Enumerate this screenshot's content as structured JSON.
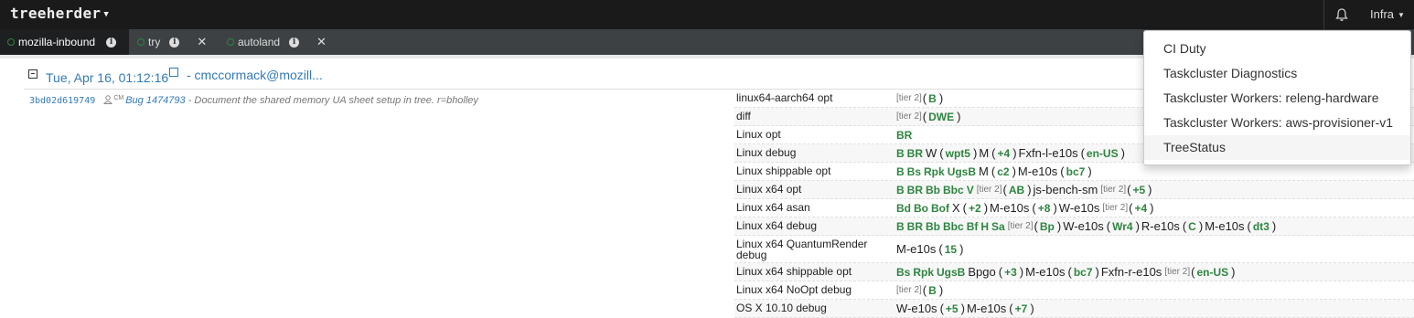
{
  "navbar": {
    "logo_text": "treeherder",
    "bell_icon": "bell-icon",
    "menu_label": "Infra"
  },
  "repo_tabs": [
    {
      "name": "mozilla-inbound",
      "active": true,
      "closable": false
    },
    {
      "name": "try",
      "active": false,
      "closable": true
    },
    {
      "name": "autoland",
      "active": false,
      "closable": true
    }
  ],
  "push": {
    "date": "Tue, Apr 16, 01:12:16",
    "author": " - cmccormack@mozill..."
  },
  "revision": {
    "hash": "3bd02d619749",
    "cm_mark": "CM",
    "bug": "Bug 1474793",
    "description": " - Document the shared memory UA sheet setup in tree. r=bholley"
  },
  "jobs": [
    {
      "platform": "linux64-aarch64 opt",
      "tokens": [
        [
          "tier",
          "[tier 2]"
        ],
        [
          "par",
          "("
        ],
        [
          "g",
          "B"
        ],
        [
          "par",
          ")"
        ]
      ]
    },
    {
      "platform": "diff",
      "tokens": [
        [
          "tier",
          "[tier 2]"
        ],
        [
          "par",
          "("
        ],
        [
          "g",
          "DWE"
        ],
        [
          "par",
          ")"
        ]
      ]
    },
    {
      "platform": "Linux opt",
      "tokens": [
        [
          "g",
          "BR"
        ]
      ]
    },
    {
      "platform": "Linux debug",
      "tokens": [
        [
          "g",
          "B"
        ],
        [
          "g",
          "BR"
        ],
        [
          "grp",
          "W"
        ],
        [
          "par",
          "("
        ],
        [
          "g",
          "wpt5"
        ],
        [
          "par",
          ")"
        ],
        [
          "grp",
          "M"
        ],
        [
          "par",
          "("
        ],
        [
          "g",
          "+4"
        ],
        [
          "par",
          ")"
        ],
        [
          "grp",
          "Fxfn-l-e10s"
        ],
        [
          "par",
          "("
        ],
        [
          "g",
          "en-US"
        ],
        [
          "par",
          ")"
        ]
      ]
    },
    {
      "platform": "Linux shippable opt",
      "tokens": [
        [
          "g",
          "B"
        ],
        [
          "g",
          "Bs"
        ],
        [
          "g",
          "Rpk"
        ],
        [
          "g",
          "UgsB"
        ],
        [
          "grp",
          "M"
        ],
        [
          "par",
          "("
        ],
        [
          "g",
          "c2"
        ],
        [
          "par",
          ")"
        ],
        [
          "grp",
          "M-e10s"
        ],
        [
          "par",
          "("
        ],
        [
          "g",
          "bc7"
        ],
        [
          "par",
          ")"
        ]
      ]
    },
    {
      "platform": "Linux x64 opt",
      "tokens": [
        [
          "g",
          "B"
        ],
        [
          "g",
          "BR"
        ],
        [
          "g",
          "Bb"
        ],
        [
          "g",
          "Bbc"
        ],
        [
          "g",
          "V"
        ],
        [
          "tier",
          "[tier 2]"
        ],
        [
          "par",
          "("
        ],
        [
          "g",
          "AB"
        ],
        [
          "par",
          ")"
        ],
        [
          "grp",
          "js-bench-sm"
        ],
        [
          "tier",
          "[tier 2]"
        ],
        [
          "par",
          "("
        ],
        [
          "g",
          "+5"
        ],
        [
          "par",
          ")"
        ]
      ]
    },
    {
      "platform": "Linux x64 asan",
      "tokens": [
        [
          "g",
          "Bd"
        ],
        [
          "g",
          "Bo"
        ],
        [
          "g",
          "Bof"
        ],
        [
          "grp",
          "X"
        ],
        [
          "par",
          "("
        ],
        [
          "g",
          "+2"
        ],
        [
          "par",
          ")"
        ],
        [
          "grp",
          "M-e10s"
        ],
        [
          "par",
          "("
        ],
        [
          "g",
          "+8"
        ],
        [
          "par",
          ")"
        ],
        [
          "grp",
          "W-e10s"
        ],
        [
          "tier",
          "[tier 2]"
        ],
        [
          "par",
          "("
        ],
        [
          "g",
          "+4"
        ],
        [
          "par",
          ")"
        ]
      ]
    },
    {
      "platform": "Linux x64 debug",
      "tokens": [
        [
          "g",
          "B"
        ],
        [
          "g",
          "BR"
        ],
        [
          "g",
          "Bb"
        ],
        [
          "g",
          "Bbc"
        ],
        [
          "g",
          "Bf"
        ],
        [
          "g",
          "H"
        ],
        [
          "g",
          "Sa"
        ],
        [
          "tier",
          "[tier 2]"
        ],
        [
          "par",
          "("
        ],
        [
          "g",
          "Bp"
        ],
        [
          "par",
          ")"
        ],
        [
          "grp",
          "W-e10s"
        ],
        [
          "par",
          "("
        ],
        [
          "g",
          "Wr4"
        ],
        [
          "par",
          ")"
        ],
        [
          "grp",
          "R-e10s"
        ],
        [
          "par",
          "("
        ],
        [
          "g",
          "C"
        ],
        [
          "par",
          ")"
        ],
        [
          "grp",
          "M-e10s"
        ],
        [
          "par",
          "("
        ],
        [
          "g",
          "dt3"
        ],
        [
          "par",
          ")"
        ]
      ]
    },
    {
      "platform": "Linux x64 QuantumRender debug",
      "tall": true,
      "tokens": [
        [
          "grp",
          "M-e10s"
        ],
        [
          "par",
          "("
        ],
        [
          "g",
          "15"
        ],
        [
          "par",
          ")"
        ]
      ]
    },
    {
      "platform": "Linux x64 shippable opt",
      "tokens": [
        [
          "g",
          "Bs"
        ],
        [
          "g",
          "Rpk"
        ],
        [
          "g",
          "UgsB"
        ],
        [
          "grp",
          "Bpgo"
        ],
        [
          "par",
          "("
        ],
        [
          "g",
          "+3"
        ],
        [
          "par",
          ")"
        ],
        [
          "grp",
          "M-e10s"
        ],
        [
          "par",
          "("
        ],
        [
          "g",
          "bc7"
        ],
        [
          "par",
          ")"
        ],
        [
          "grp",
          "Fxfn-r-e10s"
        ],
        [
          "tier",
          "[tier 2]"
        ],
        [
          "par",
          "("
        ],
        [
          "g",
          "en-US"
        ],
        [
          "par",
          ")"
        ]
      ]
    },
    {
      "platform": "Linux x64 NoOpt debug",
      "tokens": [
        [
          "tier",
          "[tier 2]"
        ],
        [
          "par",
          "("
        ],
        [
          "g",
          "B"
        ],
        [
          "par",
          ")"
        ]
      ]
    },
    {
      "platform": "OS X 10.10 debug",
      "tokens": [
        [
          "grp",
          "W-e10s"
        ],
        [
          "par",
          "("
        ],
        [
          "g",
          "+5"
        ],
        [
          "par",
          ")"
        ],
        [
          "grp",
          "M-e10s"
        ],
        [
          "par",
          "("
        ],
        [
          "g",
          "+7"
        ],
        [
          "par",
          ")"
        ]
      ]
    }
  ],
  "dropdown": {
    "items": [
      "CI Duty",
      "Taskcluster Diagnostics",
      "Taskcluster Workers: releng-hardware",
      "Taskcluster Workers: aws-provisioner-v1",
      "TreeStatus"
    ],
    "hovered_index": 4
  },
  "colors": {
    "navbar": "#1a1a1a",
    "tabbar": "#3d4144",
    "link": "#337ab7",
    "success": "#2e8540"
  }
}
